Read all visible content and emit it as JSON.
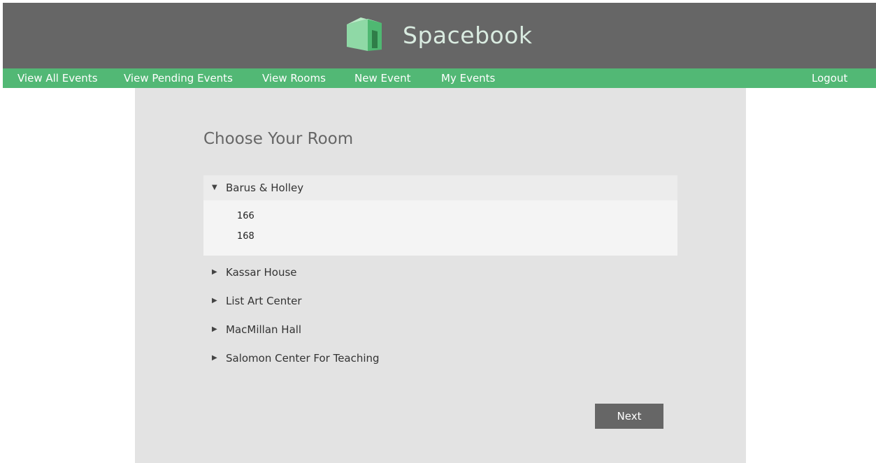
{
  "header": {
    "brand_name": "Spacebook",
    "logo_icon": "green-cube-door-logo"
  },
  "nav": {
    "items": [
      {
        "label": "View All Events"
      },
      {
        "label": "View Pending Events"
      },
      {
        "label": "View Rooms"
      },
      {
        "label": "New Event"
      },
      {
        "label": "My Events"
      }
    ],
    "logout_label": "Logout"
  },
  "main": {
    "title": "Choose Your Room",
    "buildings": [
      {
        "name": "Barus & Holley",
        "expanded": true,
        "rooms": [
          "166",
          "168"
        ]
      },
      {
        "name": "Kassar House",
        "expanded": false
      },
      {
        "name": "List Art Center",
        "expanded": false
      },
      {
        "name": "MacMillan Hall",
        "expanded": false
      },
      {
        "name": "Salomon Center For Teaching",
        "expanded": false
      }
    ],
    "next_label": "Next"
  },
  "icons": {
    "expanded": "▼",
    "collapsed": "▶"
  },
  "colors": {
    "header_bg": "#666666",
    "nav_bg": "#52b875",
    "panel_bg": "#e3e3e3",
    "accent_green": "#52b875"
  }
}
